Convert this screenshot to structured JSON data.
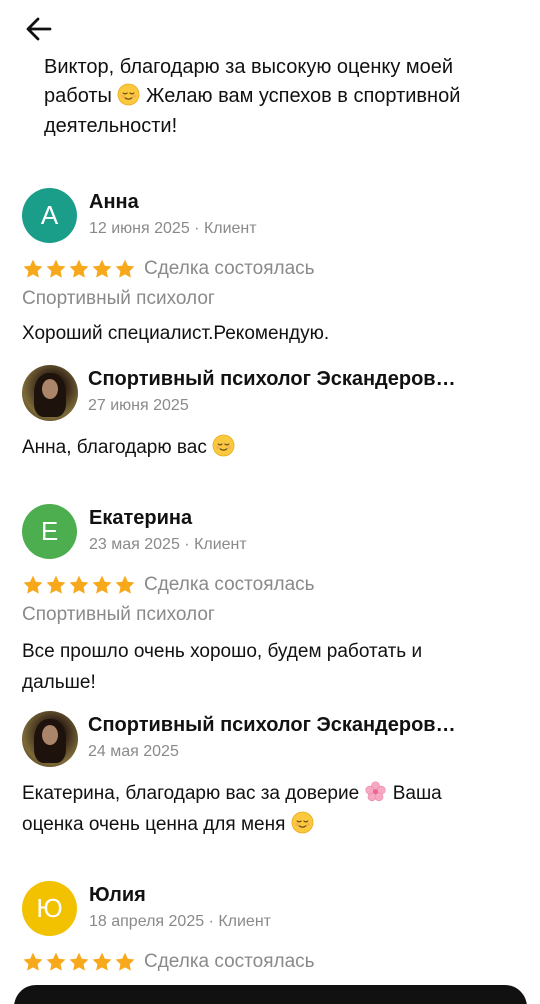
{
  "nav": {
    "back_icon": "arrow-left-icon"
  },
  "previous_reply": {
    "line1": "Виктор, благодарю за высокую оценку моей",
    "line2_a": "работы",
    "line2_b": "Желаю вам успехов в спортивной",
    "line3": "деятельности!"
  },
  "reviews": [
    {
      "initial": "А",
      "avatar_color": "#1a9e8a",
      "author": "Анна",
      "meta": "12 июня 2025 · Клиент",
      "rating": 5,
      "deal": "Сделка состоялась",
      "category": "Спортивный психолог",
      "text": "Хороший специалист.Рекомендую.",
      "reply": {
        "author": "Спортивный психолог Эскандеров…",
        "date": "27 июня 2025",
        "text": "Анна, благодарю вас"
      }
    },
    {
      "initial": "Е",
      "avatar_color": "#4cae4f",
      "author": "Екатерина",
      "meta": "23 мая 2025 · Клиент",
      "rating": 5,
      "deal": "Сделка состоялась",
      "category": "Спортивный психолог",
      "text_line1": "Все прошло очень хорошо, будем работать и",
      "text_line2": "дальше!",
      "reply": {
        "author": "Спортивный психолог Эскандеров…",
        "date": "24 мая 2025",
        "text_a": "Екатерина, благодарю вас за доверие",
        "text_b": "Ваша",
        "text_c": "оценка очень ценна для меня"
      }
    },
    {
      "initial": "Ю",
      "avatar_color": "#f2c200",
      "author": "Юлия",
      "meta": "18 апреля 2025 · Клиент",
      "rating": 5,
      "deal": "Сделка состоялась"
    }
  ],
  "colors": {
    "star": "#f7a81b",
    "muted": "#8a8a8a",
    "text": "#111111"
  }
}
